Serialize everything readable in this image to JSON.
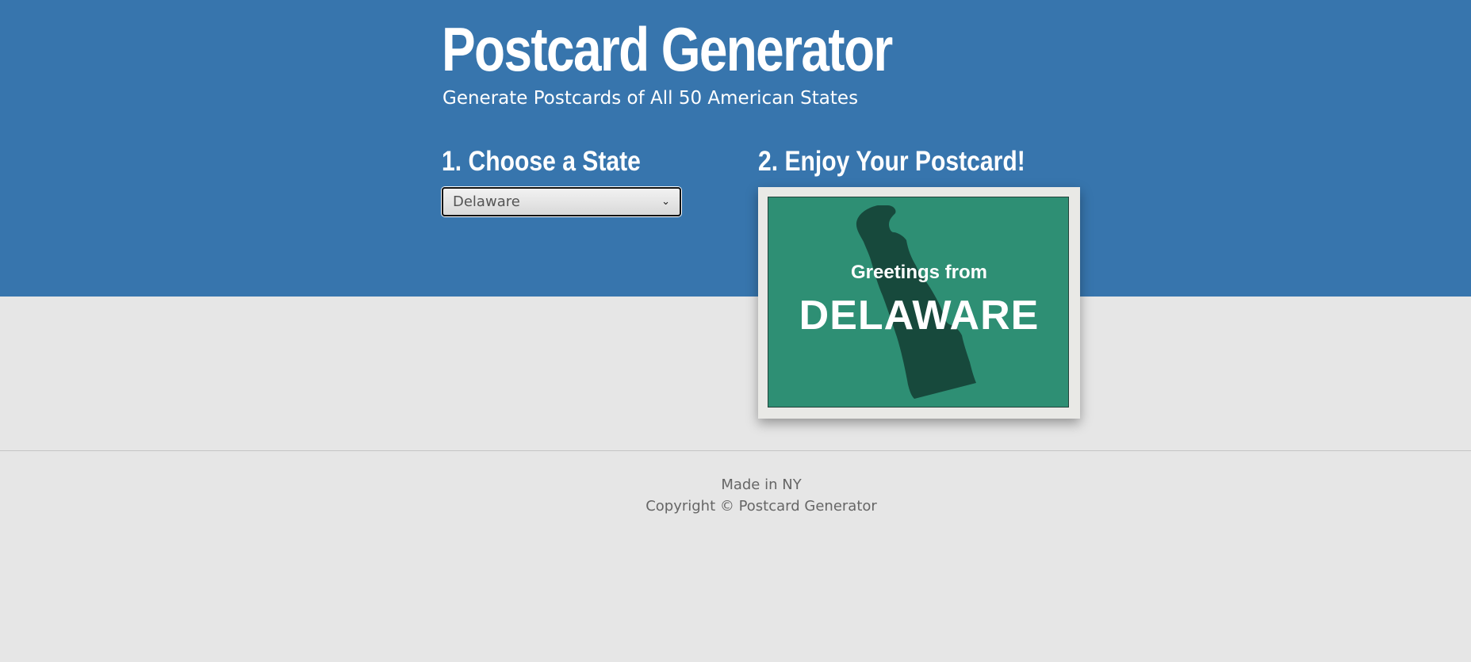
{
  "header": {
    "title": "Postcard Generator",
    "subtitle": "Generate Postcards of All 50 American States"
  },
  "steps": {
    "choose_label": "1. Choose a State",
    "enjoy_label": "2. Enjoy Your Postcard!"
  },
  "state_select": {
    "selected": "Delaware"
  },
  "postcard": {
    "greeting": "Greetings from",
    "state_name": "DELAWARE",
    "background_color": "#2e8f74",
    "silhouette_color": "#17493c"
  },
  "footer": {
    "made_in": "Made in NY",
    "copyright": "Copyright © Postcard Generator"
  },
  "colors": {
    "hero": "#3775ad",
    "page": "#e6e6e6"
  }
}
